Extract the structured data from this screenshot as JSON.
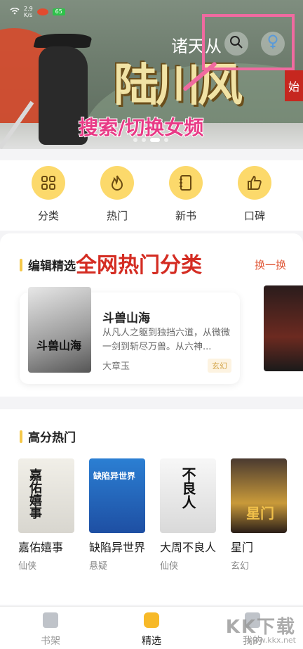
{
  "status_bar": {
    "network": "2.9",
    "network_unit": "K/s",
    "battery": "65"
  },
  "banner": {
    "subtitle": "诸天从",
    "title": "陆川风",
    "side_tag": "始",
    "annotation": "搜索/切换女频"
  },
  "categories": [
    {
      "label": "分类",
      "icon": "grid-icon"
    },
    {
      "label": "热门",
      "icon": "flame-icon"
    },
    {
      "label": "新书",
      "icon": "notebook-icon"
    },
    {
      "label": "口碑",
      "icon": "thumbs-up-icon"
    }
  ],
  "editor_picks": {
    "title": "编辑精选",
    "annotation": "全网热门分类",
    "swap_label": "换一换",
    "featured": {
      "title": "斗兽山海",
      "description": "从凡人之躯到独挡六道，从微微一剑到斩尽万兽。从六神...",
      "author": "大章玉",
      "tag": "玄幻",
      "cover_text": "斗兽山海"
    }
  },
  "high_score": {
    "title": "高分热门",
    "books": [
      {
        "name": "嘉佑嬉事",
        "genre": "仙侠",
        "cover_text": "嘉佑嬉事"
      },
      {
        "name": "缺陷异世界",
        "genre": "悬疑",
        "cover_text": "缺陷异世界"
      },
      {
        "name": "大周不良人",
        "genre": "仙侠",
        "cover_text": "不良人"
      },
      {
        "name": "星门",
        "genre": "玄幻",
        "cover_text": "星门"
      }
    ]
  },
  "bottom_nav": [
    {
      "label": "书架",
      "active": false
    },
    {
      "label": "精选",
      "active": true
    },
    {
      "label": "我的",
      "active": false
    }
  ],
  "watermark": {
    "text": "KK下载",
    "url": "www.kkx.net"
  },
  "colors": {
    "accent": "#f7b928",
    "annotation_pink": "#f06aa0",
    "annotation_red": "#d42c22"
  }
}
